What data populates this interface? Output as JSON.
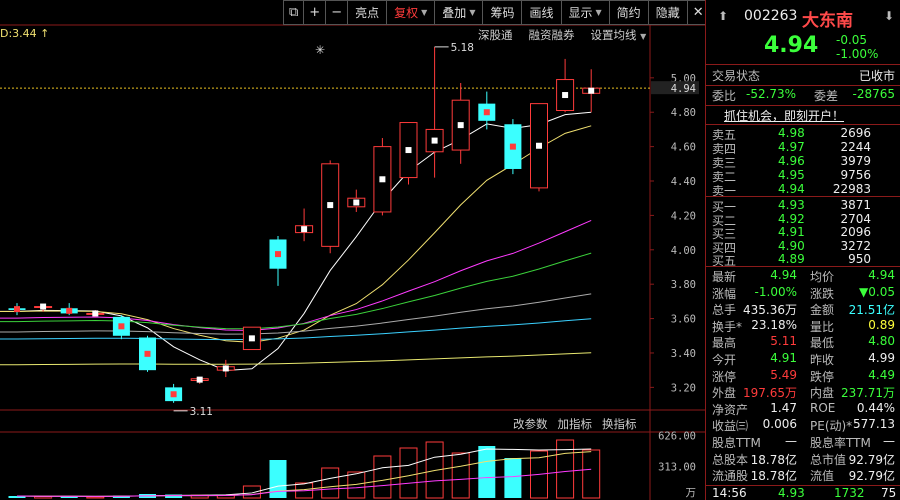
{
  "toolbar": {
    "items": [
      "亮点",
      "复权",
      "叠加",
      "筹码",
      "画线",
      "显示",
      "简约",
      "隐藏"
    ],
    "active": "复权"
  },
  "ma_label": "D:3.44 ↑",
  "top_links": [
    "深股通",
    "融资融券",
    "设置均线"
  ],
  "bottom_links": [
    "改参数",
    "加指标",
    "换指标"
  ],
  "price_axis": [
    "5.00",
    "4.80",
    "4.60",
    "4.40",
    "4.20",
    "4.00",
    "3.80",
    "3.60",
    "3.40",
    "3.20"
  ],
  "current_price_tag": "4.94",
  "high_mark": "5.18",
  "low_mark": "3.11",
  "volume_axis": [
    "626.00",
    "313.00",
    "万"
  ],
  "chart_data": {
    "type": "candlestick",
    "candles": [
      {
        "o": 3.66,
        "c": 3.65,
        "h": 3.69,
        "l": 3.62
      },
      {
        "o": 3.67,
        "c": 3.67,
        "h": 3.68,
        "l": 3.64
      },
      {
        "o": 3.66,
        "c": 3.63,
        "h": 3.69,
        "l": 3.62
      },
      {
        "o": 3.63,
        "c": 3.63,
        "h": 3.65,
        "l": 3.61
      },
      {
        "o": 3.61,
        "c": 3.5,
        "h": 3.62,
        "l": 3.48
      },
      {
        "o": 3.49,
        "c": 3.3,
        "h": 3.5,
        "l": 3.29
      },
      {
        "o": 3.2,
        "c": 3.12,
        "h": 3.22,
        "l": 3.11
      },
      {
        "o": 3.24,
        "c": 3.25,
        "h": 3.26,
        "l": 3.22
      },
      {
        "o": 3.3,
        "c": 3.32,
        "h": 3.36,
        "l": 3.26
      },
      {
        "o": 3.42,
        "c": 3.55,
        "h": 3.55,
        "l": 3.42
      },
      {
        "o": 4.06,
        "c": 3.89,
        "h": 4.08,
        "l": 3.79
      },
      {
        "o": 4.1,
        "c": 4.14,
        "h": 4.24,
        "l": 4.05
      },
      {
        "o": 4.02,
        "c": 4.5,
        "h": 4.52,
        "l": 3.98
      },
      {
        "o": 4.25,
        "c": 4.3,
        "h": 4.35,
        "l": 4.22
      },
      {
        "o": 4.22,
        "c": 4.6,
        "h": 4.65,
        "l": 4.2
      },
      {
        "o": 4.42,
        "c": 4.74,
        "h": 4.74,
        "l": 4.38
      },
      {
        "o": 4.57,
        "c": 4.7,
        "h": 5.18,
        "l": 4.42
      },
      {
        "o": 4.58,
        "c": 4.87,
        "h": 4.97,
        "l": 4.5
      },
      {
        "o": 4.85,
        "c": 4.75,
        "h": 4.92,
        "l": 4.7
      },
      {
        "o": 4.73,
        "c": 4.47,
        "h": 4.76,
        "l": 4.44
      },
      {
        "o": 4.36,
        "c": 4.85,
        "h": 4.85,
        "l": 4.34
      },
      {
        "o": 4.81,
        "c": 4.99,
        "h": 5.11,
        "l": 4.8
      },
      {
        "o": 4.91,
        "c": 4.94,
        "h": 5.05,
        "l": 4.8
      }
    ],
    "volumes": [
      20,
      15,
      18,
      12,
      25,
      40,
      35,
      28,
      30,
      120,
      380,
      150,
      300,
      260,
      420,
      500,
      560,
      450,
      520,
      400,
      470,
      580,
      480
    ]
  },
  "panel": {
    "code": "002263",
    "name": "大东南",
    "price": "4.94",
    "change": "-0.05",
    "change_pct": "-1.00%",
    "status_label": "交易状态",
    "status_value": "已收市",
    "weibi_label": "委比",
    "weibi_value": "-52.73%",
    "weicha_label": "委差",
    "weicha_value": "-28765",
    "promo": "抓住机会，即刻开户！",
    "asks": [
      {
        "label": "卖五",
        "price": "4.98",
        "vol": "2696"
      },
      {
        "label": "卖四",
        "price": "4.97",
        "vol": "2244"
      },
      {
        "label": "卖三",
        "price": "4.96",
        "vol": "3979"
      },
      {
        "label": "卖二",
        "price": "4.95",
        "vol": "9756"
      },
      {
        "label": "卖一",
        "price": "4.94",
        "vol": "22983"
      }
    ],
    "bids": [
      {
        "label": "买一",
        "price": "4.93",
        "vol": "3871"
      },
      {
        "label": "买二",
        "price": "4.92",
        "vol": "2704"
      },
      {
        "label": "买三",
        "price": "4.91",
        "vol": "2096"
      },
      {
        "label": "买四",
        "price": "4.90",
        "vol": "3272"
      },
      {
        "label": "买五",
        "price": "4.89",
        "vol": "950"
      }
    ],
    "stats": [
      {
        "l1": "最新",
        "v1": "4.94",
        "c1": "green",
        "l2": "均价",
        "v2": "4.94",
        "c2": "green"
      },
      {
        "l1": "涨幅",
        "v1": "-1.00%",
        "c1": "green",
        "l2": "涨跌",
        "v2": "▼0.05",
        "c2": "green"
      },
      {
        "l1": "总手",
        "v1": "435.36万",
        "c1": "white",
        "l2": "金额",
        "v2": "21.51亿",
        "c2": "cyan"
      },
      {
        "l1": "换手*",
        "v1": "23.18%",
        "c1": "white",
        "l2": "量比",
        "v2": "0.89",
        "c2": "yellow"
      },
      {
        "l1": "最高",
        "v1": "5.11",
        "c1": "red",
        "l2": "最低",
        "v2": "4.80",
        "c2": "green"
      },
      {
        "l1": "今开",
        "v1": "4.91",
        "c1": "green",
        "l2": "昨收",
        "v2": "4.99",
        "c2": "white"
      },
      {
        "l1": "涨停",
        "v1": "5.49",
        "c1": "red",
        "l2": "跌停",
        "v2": "4.49",
        "c2": "green"
      },
      {
        "l1": "外盘",
        "v1": "197.65万",
        "c1": "red",
        "l2": "内盘",
        "v2": "237.71万",
        "c2": "green"
      },
      {
        "l1": "净资产",
        "v1": "1.47",
        "c1": "white",
        "l2": "ROE",
        "v2": "0.44%",
        "c2": "white"
      },
      {
        "l1": "收益㈢",
        "v1": "0.006",
        "c1": "white",
        "l2": "PE(动)*",
        "v2": "577.13",
        "c2": "white"
      },
      {
        "l1": "股息TTM",
        "v1": "—",
        "c1": "white",
        "l2": "股息率TTM",
        "v2": "—",
        "c2": "white"
      },
      {
        "l1": "总股本",
        "v1": "18.78亿",
        "c1": "white",
        "l2": "总市值",
        "v2": "92.79亿",
        "c2": "white"
      },
      {
        "l1": "流通股",
        "v1": "18.78亿",
        "c1": "white",
        "l2": "流值",
        "v2": "92.79亿",
        "c2": "white"
      }
    ],
    "tick": {
      "time": "14:56",
      "price": "4.93",
      "vol": "1732",
      "num": "75"
    }
  },
  "colors": {
    "up": "#ff3b3b",
    "down": "#3bffff",
    "ma5": "#ffffff",
    "ma10": "#f0e070",
    "ma20": "#ff3bff",
    "ma30": "#3bd13b",
    "ma60": "#aaaaaa",
    "ma120": "#3bd1ff",
    "ma250": "#e8e870",
    "grid": "#8b1a1a",
    "price_dash": "#e8c020"
  }
}
